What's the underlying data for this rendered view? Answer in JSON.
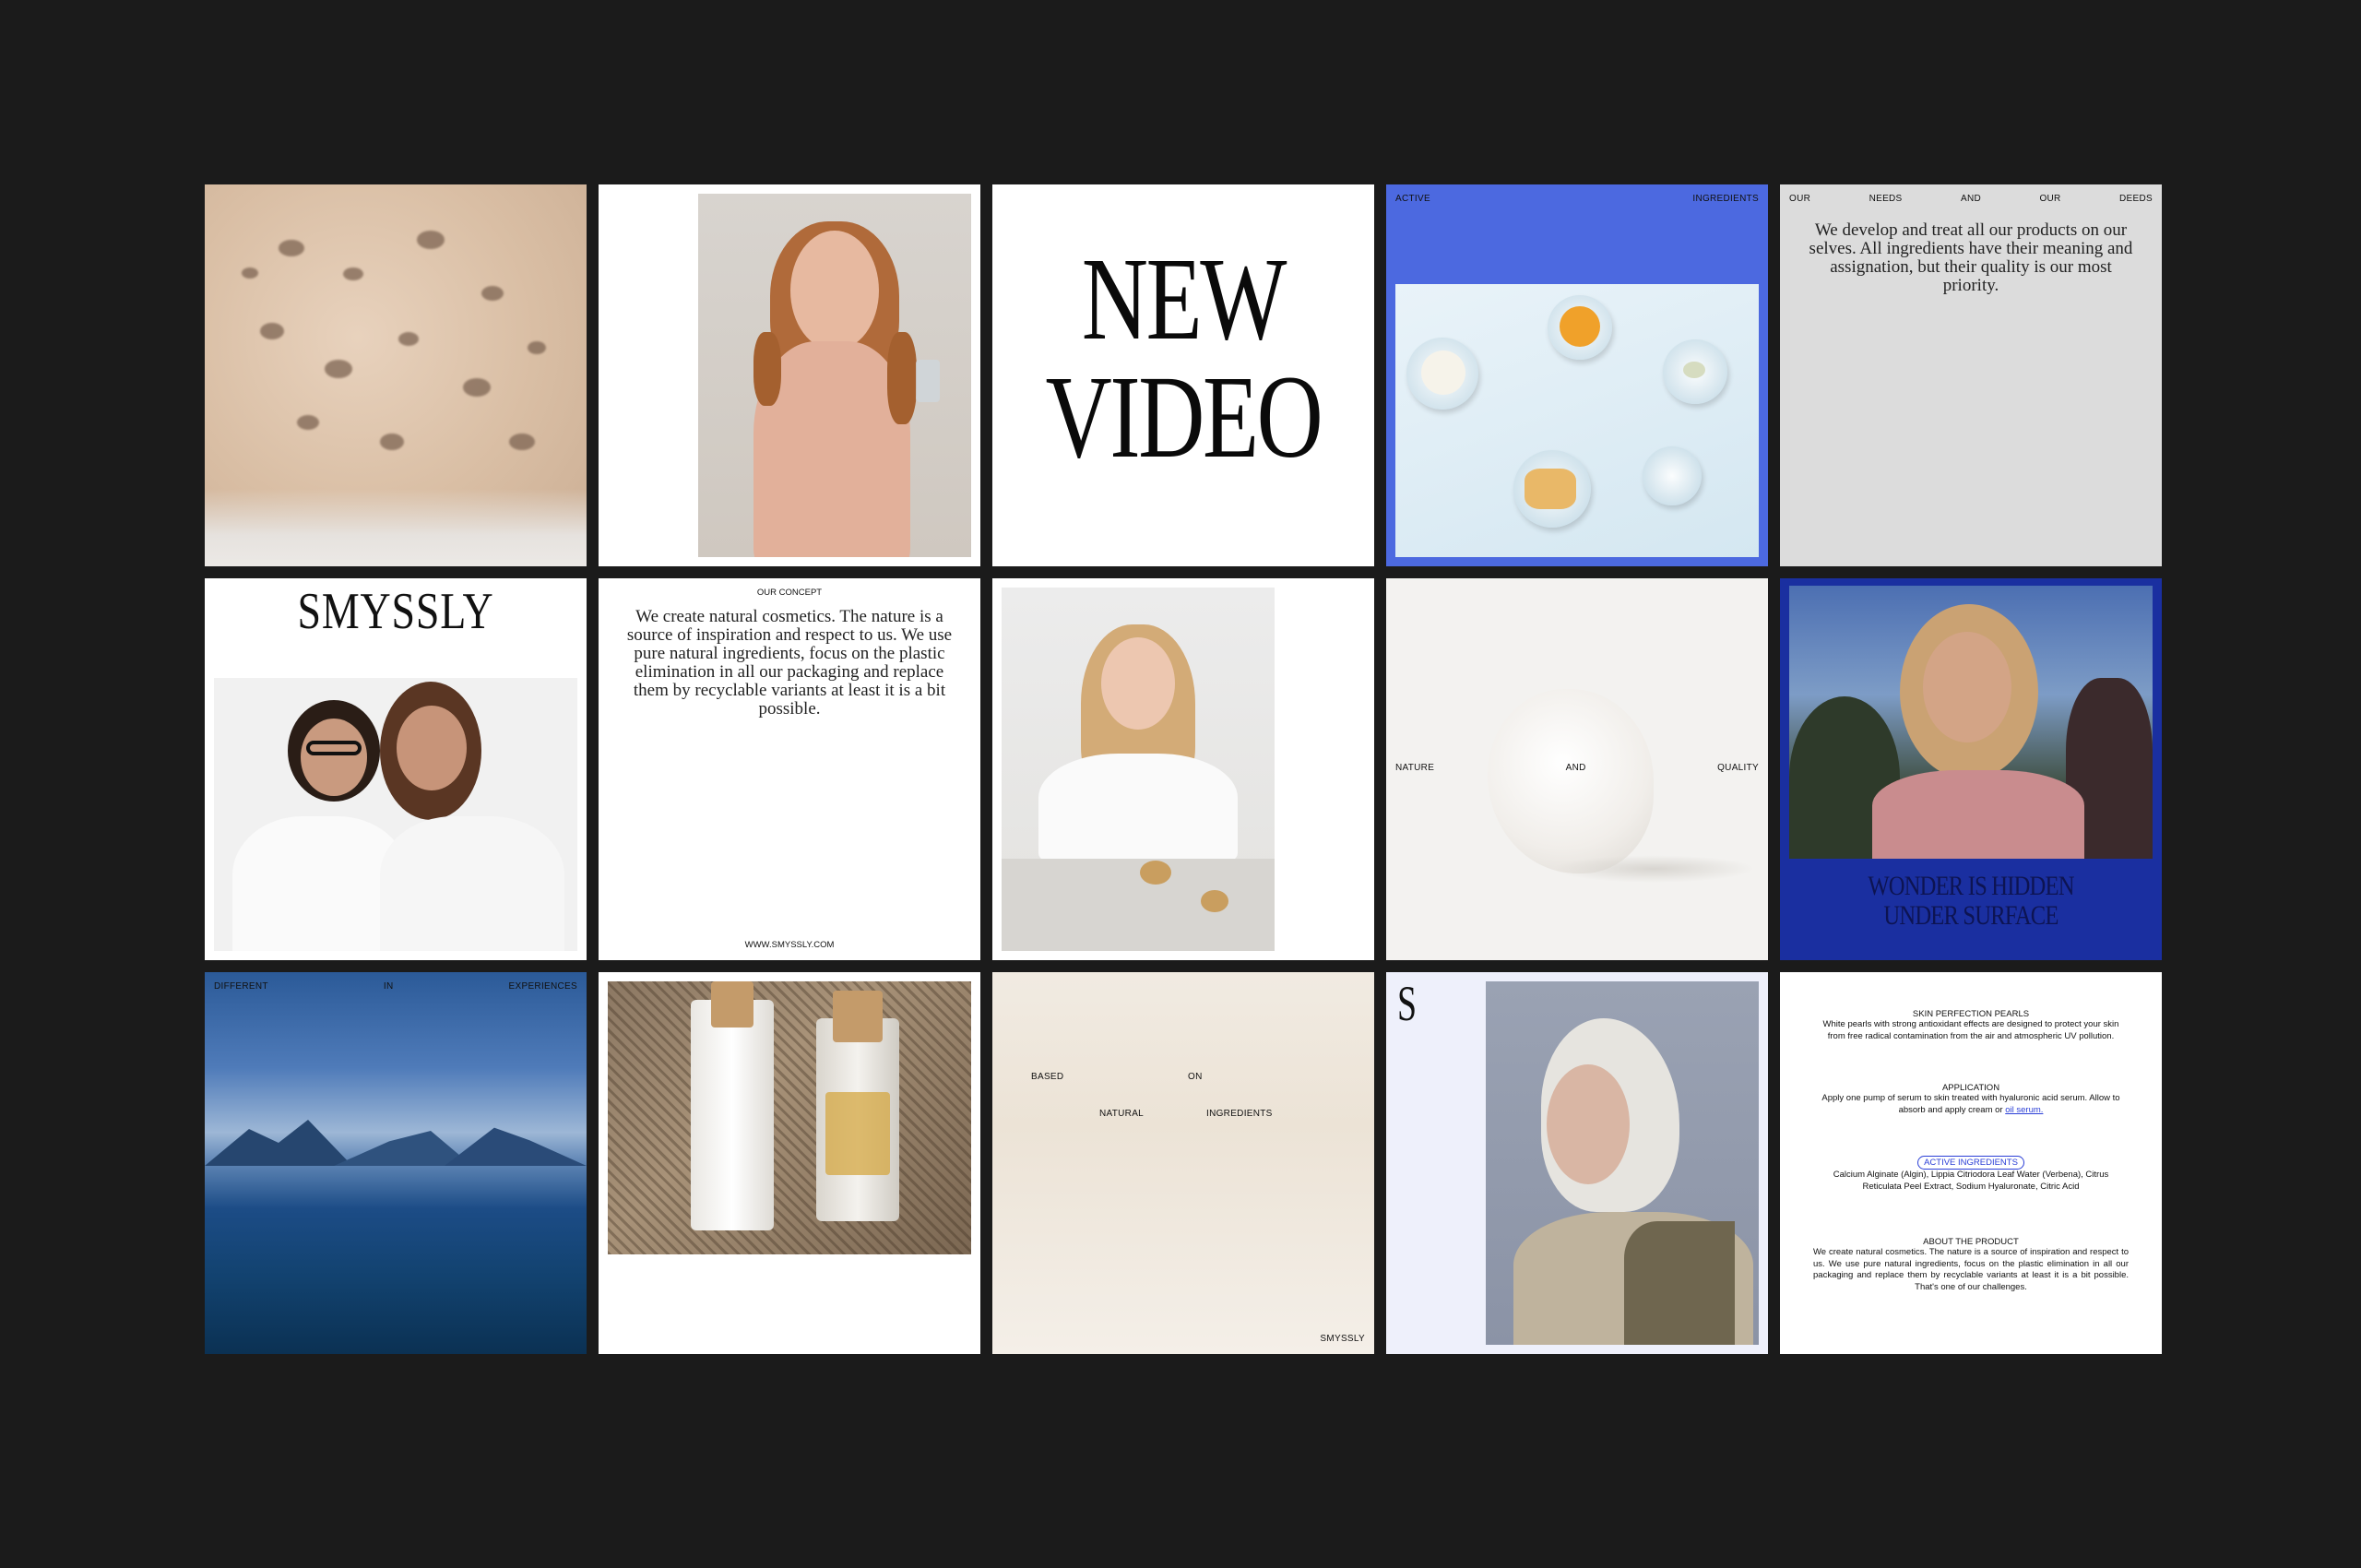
{
  "tiles": {
    "new_video": {
      "line1": "NEW",
      "line2": "VIDEO"
    },
    "active": {
      "left": "ACTIVE",
      "right": "INGREDIENTS"
    },
    "needs": {
      "words": [
        "OUR",
        "NEEDS",
        "AND",
        "OUR",
        "DEEDS"
      ],
      "text": "We develop and treat all our products on our selves. All ingredients have their meaning and assignation, but their quality is our most priority."
    },
    "logo_tile": {
      "logo": "SMYSSLY"
    },
    "concept": {
      "label": "OUR CONCEPT",
      "text": "We create natural cosmetics. The nature is a source of inspiration and respect to us. We use pure natural ingredients, focus on the plastic elimination in all our packaging and replace them by recyclable variants at least it is a bit possible.",
      "url": "WWW.SMYSSLY.COM"
    },
    "nature": {
      "left": "NATURE",
      "mid": "AND",
      "right": "QUALITY"
    },
    "wonder": {
      "line1": "WONDER IS HIDDEN",
      "line2": "UNDER SURFACE"
    },
    "different": {
      "left": "DIFFERENT",
      "mid": "IN",
      "right": "EXPERIENCES"
    },
    "based": {
      "w1": "BASED",
      "w2": "ON",
      "w3": "NATURAL",
      "w4": "INGREDIENTS",
      "brand": "SMYSSLY"
    },
    "monogram": {
      "mark": "S"
    },
    "product": {
      "h1": "SKIN PERFECTION PEARLS",
      "p1": "White pearls with strong antioxidant effects are designed to protect your skin from free radical contamination from the air and atmospheric UV pollution.",
      "h2": "APPLICATION",
      "p2a": "Apply one pump of serum to skin treated with hyaluronic acid serum. Allow to absorb and apply cream or ",
      "p2link": "oil serum.",
      "h3": "ACTIVE INGREDIENTS",
      "p3": "Calcium Alginate (Algin), Lippia Citriodora Leaf Water (Verbena), Citrus Reticulata Peel Extract, Sodium Hyaluronate, Citric Acid",
      "h4": "ABOUT THE PRODUCT",
      "p4": "We create natural cosmetics. The nature is a source of inspiration and respect to us. We use pure natural ingredients, focus on the plastic elimination in all our packaging and replace them by recyclable variants at least it is a bit possible. That's one of our challenges."
    }
  },
  "colors": {
    "background": "#1b1b1b",
    "blue_tile": "#4c69e0",
    "navy_tile": "#1a2fa0",
    "grey_tile": "#dcdcdc"
  }
}
